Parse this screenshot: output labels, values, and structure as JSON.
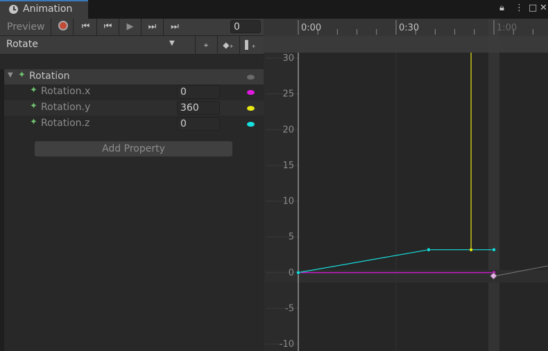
{
  "window": {
    "tab_title": "Animation",
    "lock_icon": "lock-icon",
    "menu_icon": "kebab-menu-icon",
    "maximize_icon": "maximize-icon",
    "close_icon": "close-icon"
  },
  "toolbar": {
    "preview_label": "Preview",
    "record_icon": "record-icon",
    "first_key_icon": "first-keyframe-icon",
    "prev_key_icon": "previous-keyframe-icon",
    "play_icon": "play-icon",
    "next_key_icon": "next-keyframe-icon",
    "last_key_icon": "last-keyframe-icon",
    "frame_value": "0"
  },
  "clip": {
    "selected": "Rotate",
    "filter_icon": "filter-keys-icon",
    "add_keyframe_icon": "add-keyframe-icon",
    "add_event_icon": "add-event-icon"
  },
  "properties": {
    "group_label": "Rotation",
    "items": [
      {
        "label": "Rotation.x",
        "value": "0",
        "color": "#e018e0"
      },
      {
        "label": "Rotation.y",
        "value": "360",
        "color": "#e8e816"
      },
      {
        "label": "Rotation.z",
        "value": "0",
        "color": "#16e0e0"
      }
    ],
    "add_property_label": "Add Property"
  },
  "timeline": {
    "time_labels": [
      "0:00",
      "0:30",
      "1:00"
    ],
    "y_labels": [
      "30",
      "25",
      "20",
      "15",
      "10",
      "5",
      "0",
      "-5",
      "-10"
    ]
  },
  "chart_data": {
    "type": "line",
    "xlabel": "",
    "ylabel": "",
    "x_unit": "frames",
    "ylim": [
      -10,
      30
    ],
    "xlim": [
      0,
      60
    ],
    "series": [
      {
        "name": "Rotation.x",
        "color": "#e018e0",
        "points": [
          [
            0,
            0
          ],
          [
            60,
            0
          ]
        ]
      },
      {
        "name": "Rotation.y",
        "color": "#e8e816",
        "points": [
          [
            53,
            3.2
          ],
          [
            53,
            360
          ]
        ]
      },
      {
        "name": "Rotation.z",
        "color": "#16e0e0",
        "points": [
          [
            0,
            0
          ],
          [
            40,
            3.2
          ],
          [
            60,
            3.2
          ]
        ]
      }
    ]
  }
}
